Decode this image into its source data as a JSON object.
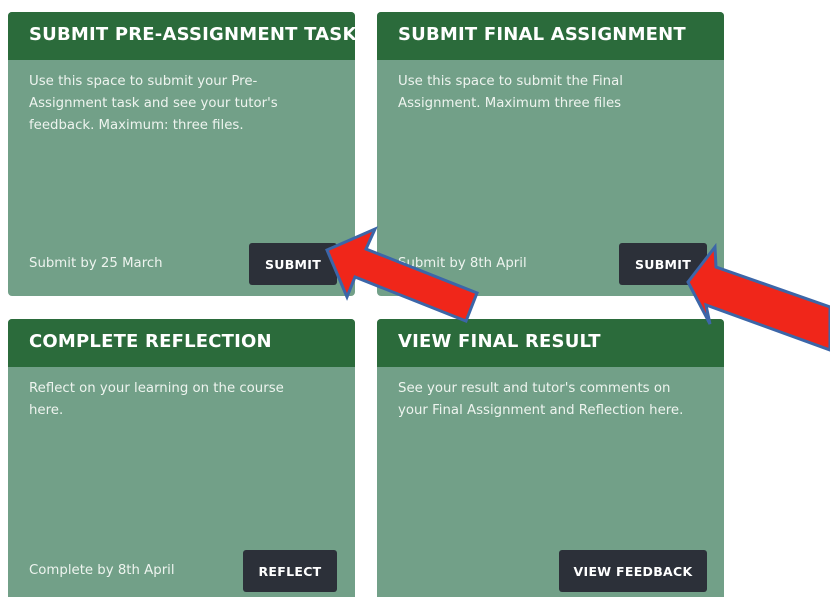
{
  "cards": [
    {
      "title": "SUBMIT PRE-ASSIGNMENT TASK",
      "description": "Use this space to submit your Pre-Assignment task and see your tutor's feedback. Maximum: three files.",
      "footer": "Submit by 25 March",
      "button": "SUBMIT"
    },
    {
      "title": "SUBMIT FINAL ASSIGNMENT",
      "description": "Use this space to submit the Final Assignment. Maximum three files",
      "footer": "Submit by 8th April",
      "button": "SUBMIT"
    },
    {
      "title": "COMPLETE REFLECTION",
      "description": "Reflect on your learning on the course here.",
      "footer": "Complete by 8th April",
      "button": "REFLECT"
    },
    {
      "title": "VIEW FINAL RESULT",
      "description": "See your result and tutor's comments on your Final Assignment and Reflection here.",
      "footer": "",
      "button": "VIEW FEEDBACK"
    }
  ],
  "colors": {
    "card_body": "#72a088",
    "card_header": "#2b6b3b",
    "button": "#2c3039",
    "annotation_arrow": "#f0261a"
  },
  "annotations": [
    "arrow-to-submit-pre-assignment",
    "arrow-to-submit-final-assignment"
  ]
}
